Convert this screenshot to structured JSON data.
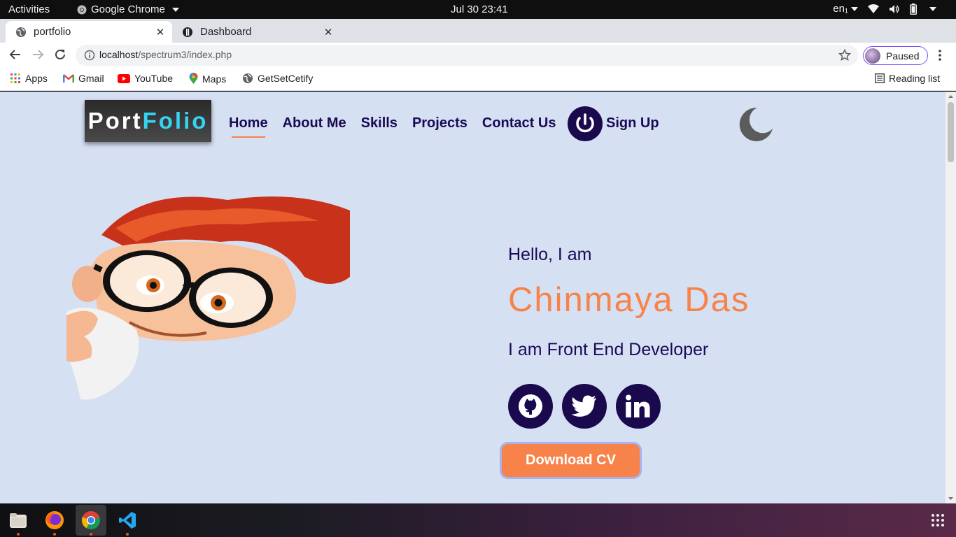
{
  "system_bar": {
    "activities": "Activities",
    "app_name": "Google Chrome",
    "clock": "Jul 30  23:41",
    "language": "en₁"
  },
  "browser": {
    "tabs": [
      {
        "title": "portfolio",
        "active": true
      },
      {
        "title": "Dashboard",
        "active": false
      }
    ],
    "url_host": "localhost",
    "url_path": "/spectrum3/index.php",
    "profile_label": "Paused",
    "bookmarks": [
      {
        "label": "Apps",
        "icon": "apps-grid-icon"
      },
      {
        "label": "Gmail",
        "icon": "gmail-icon"
      },
      {
        "label": "YouTube",
        "icon": "youtube-icon"
      },
      {
        "label": "Maps",
        "icon": "maps-icon"
      },
      {
        "label": "GetSetCetify",
        "icon": "globe-icon"
      }
    ],
    "reading_list": "Reading list"
  },
  "site": {
    "logo_part1": "Port",
    "logo_part2": "Folio",
    "nav": [
      {
        "label": "Home",
        "active": true
      },
      {
        "label": "About Me",
        "active": false
      },
      {
        "label": "Skills",
        "active": false
      },
      {
        "label": "Projects",
        "active": false
      },
      {
        "label": "Contact Us",
        "active": false
      }
    ],
    "signup": "Sign Up",
    "hero": {
      "greeting": "Hello, I am",
      "name": "Chinmaya Das",
      "role": "I am Front End Developer",
      "social": [
        "github-icon",
        "twitter-icon",
        "linkedin-icon"
      ],
      "cta": "Download CV"
    }
  },
  "colors": {
    "page_bg": "#d6e0f3",
    "navy": "#1a0a4d",
    "accent_orange": "#f7834a",
    "logo_cyan": "#35d4f1"
  }
}
